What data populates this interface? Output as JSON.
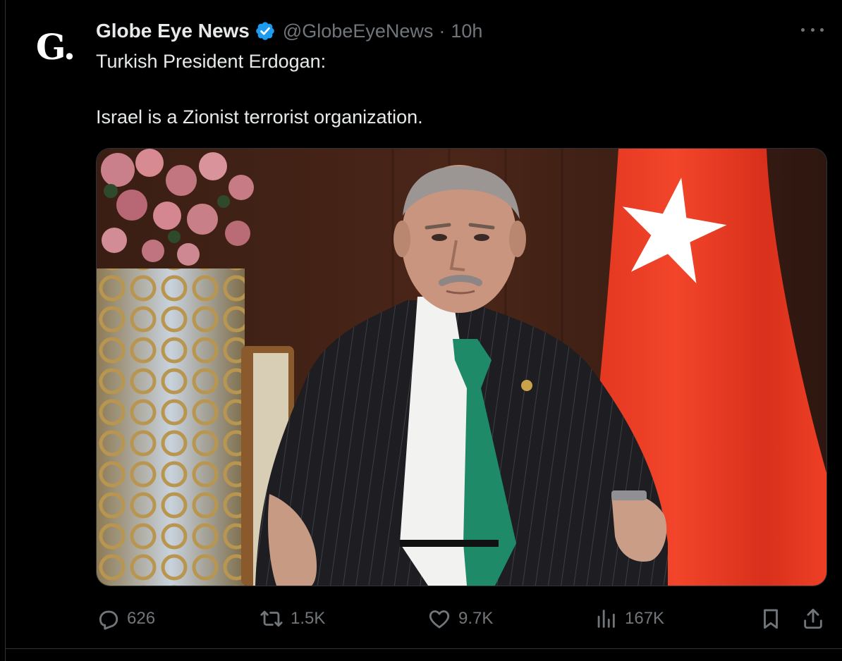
{
  "tweet": {
    "author": {
      "avatar_text": "G.",
      "display_name": "Globe Eye News",
      "verified": true,
      "handle": "@GlobeEyeNews",
      "separator": "·",
      "timestamp": "10h"
    },
    "text_lines": [
      "Turkish President Erdogan:",
      "Israel is a Zionist terrorist organization."
    ],
    "media": {
      "type": "photo"
    },
    "actions": {
      "replies": "626",
      "reposts": "1.5K",
      "likes": "9.7K",
      "views": "167K"
    }
  },
  "icons": {
    "more": "more-horizontal-icon",
    "verified": "verified-badge-icon",
    "reply": "reply-icon",
    "repost": "repost-icon",
    "like": "heart-icon",
    "views": "analytics-icon",
    "bookmark": "bookmark-icon",
    "share": "share-icon"
  },
  "colors": {
    "background": "#000000",
    "text_primary": "#e7e9ea",
    "text_secondary": "#71767b",
    "verified_blue": "#1d9bf0",
    "border": "#2f3336"
  }
}
